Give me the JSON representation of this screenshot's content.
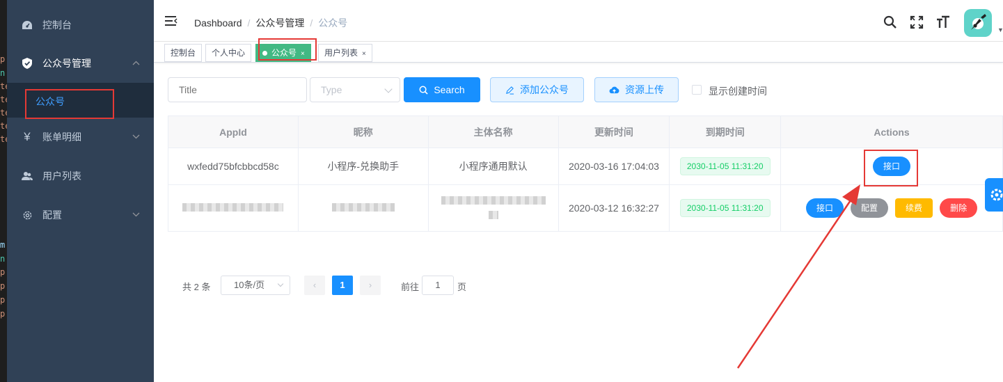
{
  "editor_strip": {
    "glyphs": [
      "p",
      "n",
      "te",
      "te",
      "te",
      "te",
      "te",
      "m",
      "n",
      "p",
      "p",
      "p",
      "p"
    ]
  },
  "sidebar": {
    "items": [
      {
        "label": "控制台",
        "icon": "dashboard-icon"
      },
      {
        "label": "公众号管理",
        "icon": "shield-icon"
      },
      {
        "label": "账单明细",
        "icon": "yen-icon"
      },
      {
        "label": "用户列表",
        "icon": "user-icon"
      },
      {
        "label": "配置",
        "icon": "gear-icon"
      }
    ],
    "active_sub": "公众号"
  },
  "navbar": {
    "breadcrumb": [
      "Dashboard",
      "公众号管理",
      "公众号"
    ],
    "separator": "/"
  },
  "tags": [
    {
      "label": "控制台"
    },
    {
      "label": "个人中心"
    },
    {
      "label": "公众号",
      "close": "×"
    },
    {
      "label": "用户列表",
      "close": "×"
    }
  ],
  "filters": {
    "title_placeholder": "Title",
    "type_placeholder": "Type",
    "search_label": "Search",
    "add_label": "添加公众号",
    "upload_label": "资源上传",
    "show_time_label": "显示创建时间"
  },
  "table": {
    "headers": [
      "AppId",
      "昵称",
      "主体名称",
      "更新时间",
      "到期时间",
      "Actions"
    ],
    "rows": [
      {
        "appid": "wxfedd75bfcbbcd58c",
        "nickname": "小程序-兑换助手",
        "entity": "小程序通用默认",
        "updated": "2020-03-16 17:04:03",
        "expires": "2030-11-05 11:31:20",
        "actions": [
          "接口"
        ]
      },
      {
        "appid": "",
        "nickname": "",
        "entity": "",
        "updated": "2020-03-12 16:32:27",
        "expires": "2030-11-05 11:31:20",
        "actions": [
          "接口",
          "配置",
          "续费",
          "删除"
        ]
      }
    ]
  },
  "pagination": {
    "total": "共 2 条",
    "page_size": "10条/页",
    "current": "1",
    "goto_prefix": "前往",
    "goto_value": "1",
    "goto_suffix": "页",
    "prev": "‹",
    "next": "›"
  },
  "colors": {
    "sidebar": "#304156",
    "primary": "#1890ff",
    "active_tag": "#42b983",
    "annotation": "#e53935"
  }
}
